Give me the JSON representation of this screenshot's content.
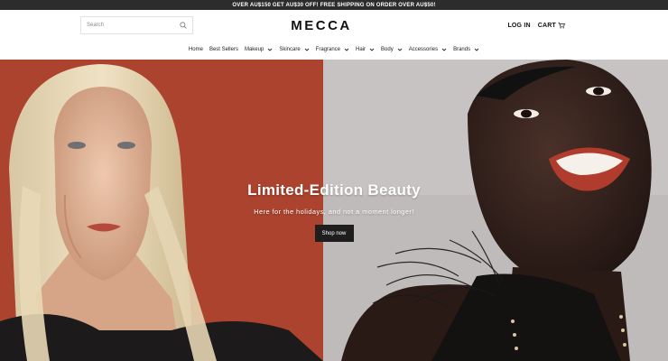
{
  "promo": {
    "text": "OVER AU$150 GET AU$30 OFF! FREE SHIPPING ON ORDER OVER AU$50!"
  },
  "header": {
    "search_placeholder": "Search",
    "logo": "MECCA",
    "login_label": "LOG IN",
    "cart_label": "CART"
  },
  "nav": {
    "items": [
      {
        "label": "Home",
        "has_dropdown": false
      },
      {
        "label": "Best Sellers",
        "has_dropdown": false
      },
      {
        "label": "Makeup",
        "has_dropdown": true
      },
      {
        "label": "Skincare",
        "has_dropdown": true
      },
      {
        "label": "Fragrance",
        "has_dropdown": true
      },
      {
        "label": "Hair",
        "has_dropdown": true
      },
      {
        "label": "Body",
        "has_dropdown": true
      },
      {
        "label": "Accessories",
        "has_dropdown": true
      },
      {
        "label": "Brands",
        "has_dropdown": true
      }
    ]
  },
  "hero": {
    "title": "Limited-Edition Beauty",
    "subtitle": "Here for the holidays, and not a moment longer!",
    "cta_label": "Shop now",
    "left_bg": "#a6402d",
    "right_bg": "#c7c3c2"
  },
  "colors": {
    "promo_bg": "#2c2c2c",
    "cta_bg": "#1e1e1e"
  },
  "icons": {
    "search": "search-icon",
    "cart": "cart-icon",
    "dropdown": "chevron-down-icon"
  }
}
